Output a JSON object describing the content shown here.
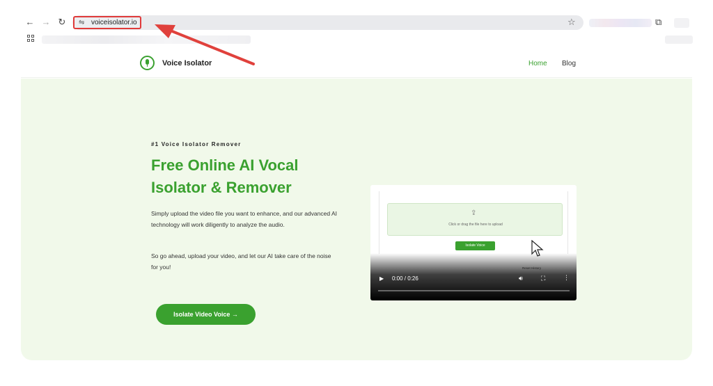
{
  "browser": {
    "url": "voiceisolator.io",
    "icons": {
      "back": "arrow-left-icon",
      "forward": "arrow-right-icon",
      "reload": "reload-icon",
      "site_info": "tune-icon",
      "bookmark": "star-icon",
      "extensions": "puzzle-icon",
      "apps": "apps-grid-icon"
    }
  },
  "site": {
    "brand": "Voice Isolator",
    "nav": {
      "home": "Home",
      "blog": "Blog"
    },
    "accent_color": "#3aa12f"
  },
  "hero": {
    "eyebrow": "#1 Voice Isolator Remover",
    "title": "Free Online AI Vocal Isolator & Remover",
    "paragraph1": "Simply upload the video file you want to enhance, and our advanced AI technology will work diligently to analyze the audio.",
    "paragraph2": "So go ahead, upload your video, and let our AI take care of the noise for you!",
    "cta": "Isolate Video Voice →"
  },
  "video": {
    "drop_text": "Click or drag the file here to upload",
    "isolate_button": "Isolate Voice",
    "links": "Reset    History",
    "time": "0:00 / 0:26",
    "progress": 0.0
  }
}
